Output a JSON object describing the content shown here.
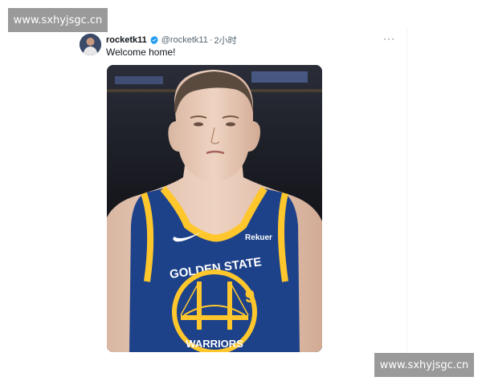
{
  "watermark": {
    "text": "www.sxhyjsgc.cn"
  },
  "tweet": {
    "display_name": "rocketk11",
    "handle": "@rocketk11",
    "separator": "·",
    "time": "2小时",
    "text": "Welcome home!",
    "more": "···"
  },
  "media": {
    "jersey_team": "GOLDEN STATE",
    "jersey_number": "9",
    "sponsor": "Rekuer",
    "jersey_bottom": "WARRIORS"
  },
  "colors": {
    "verified": "#1d9bf0",
    "jersey_blue": "#1d428a",
    "jersey_gold": "#ffc72c"
  },
  "icons": [
    "verified-icon",
    "more-icon",
    "nike-swoosh-icon",
    "bridge-logo-icon"
  ]
}
